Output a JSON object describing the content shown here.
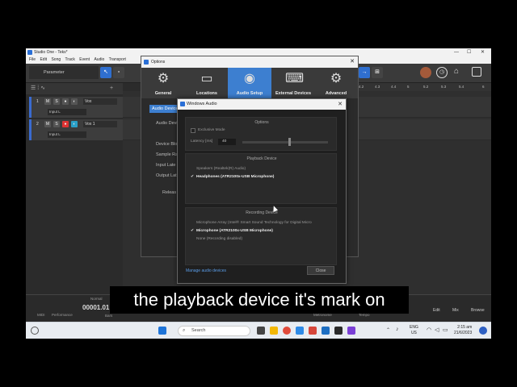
{
  "app": {
    "title": "Studio One - Teks*",
    "menus": [
      "File",
      "Edit",
      "Song",
      "Track",
      "Event",
      "Audio",
      "Transport"
    ]
  },
  "toolbar": {
    "parameter_label": "Parameter"
  },
  "ruler": {
    "marks": [
      "4.2",
      "4.3",
      "4.4",
      "5",
      "5.2",
      "5.3",
      "5.4",
      "6"
    ]
  },
  "tracks": [
    {
      "number": "1",
      "m": "M",
      "s": "S",
      "name": "Vox",
      "input": "Input L"
    },
    {
      "number": "2",
      "m": "M",
      "s": "S",
      "name": "Vox 1",
      "input": "Input L"
    }
  ],
  "options": {
    "title": "Options",
    "tabs": [
      {
        "label": "General",
        "icon": "gear-icon"
      },
      {
        "label": "Locations",
        "icon": "drive-icon"
      },
      {
        "label": "Audio Setup",
        "icon": "speaker-icon"
      },
      {
        "label": "External Devices",
        "icon": "keyboard-icon"
      },
      {
        "label": "Advanced",
        "icon": "gears-icon"
      }
    ],
    "subtab": "Audio Device",
    "rows": [
      "Audio Devi",
      "Device Blo",
      "Sample Ra",
      "Input Late",
      "Output Lat",
      "Releas"
    ]
  },
  "windows_audio": {
    "title": "Windows Audio",
    "options_header": "Options",
    "exclusive_mode": "Exclusive Mode",
    "latency_label": "Latency [ms]",
    "latency_value": "40",
    "latency_level": 0.55,
    "playback_header": "Playback Device",
    "playback_devices": [
      {
        "name": "Speakers (Realtek(R) Audio)",
        "selected": false
      },
      {
        "name": "Headphones (ATR2100x-USB Microphone)",
        "selected": true
      }
    ],
    "recording_header": "Recording Device",
    "recording_devices": [
      {
        "name": "Microphone Array (Intel® Smart Sound Technology for Digital Micro",
        "selected": false
      },
      {
        "name": "Microphone (ATR2100x-USB Microphone)",
        "selected": true
      },
      {
        "name": "None (Recording disabled)",
        "selected": false
      }
    ],
    "manage_link": "Manage audio devices",
    "close_label": "Close"
  },
  "transport": {
    "midi_label": "MIDI",
    "performance_label": "Performance",
    "time": "00001.01",
    "bars_label": "Bars",
    "mode": "Normal",
    "metronome_label": "Metronome",
    "tempo_label": "Tempo",
    "tabs": [
      "Edit",
      "Mix",
      "Browse"
    ]
  },
  "taskbar": {
    "search_placeholder": "Search",
    "lang_line1": "ENG",
    "lang_line2": "US",
    "time": "2:15 am",
    "date": "21/6/2023"
  },
  "caption": "the playback device it's mark on"
}
